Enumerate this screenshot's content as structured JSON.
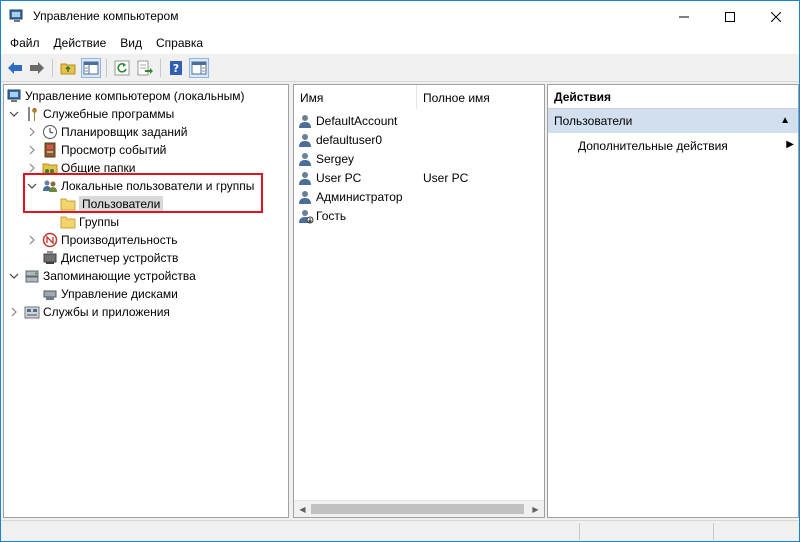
{
  "window": {
    "title": "Управление компьютером"
  },
  "menu": [
    "Файл",
    "Действие",
    "Вид",
    "Справка"
  ],
  "tree": {
    "root": "Управление компьютером (локальным)",
    "system_tools": "Служебные программы",
    "task_scheduler": "Планировщик заданий",
    "event_viewer": "Просмотр событий",
    "shared_folders": "Общие папки",
    "local_users": "Локальные пользователи и группы",
    "users": "Пользователи",
    "groups": "Группы",
    "performance": "Производительность",
    "device_manager": "Диспетчер устройств",
    "storage": "Запоминающие устройства",
    "disk_management": "Управление дисками",
    "services_apps": "Службы и приложения"
  },
  "list": {
    "columns": [
      "Имя",
      "Полное имя"
    ],
    "rows": [
      {
        "name": "DefaultAccount",
        "full_name": ""
      },
      {
        "name": "defaultuser0",
        "full_name": ""
      },
      {
        "name": "Sergey",
        "full_name": ""
      },
      {
        "name": "User PC",
        "full_name": "User PC"
      },
      {
        "name": "Администратор",
        "full_name": ""
      },
      {
        "name": "Гость",
        "full_name": ""
      }
    ]
  },
  "actions": {
    "header": "Действия",
    "section": "Пользователи",
    "more": "Дополнительные действия"
  },
  "colors": {
    "accent": "#1883d7",
    "highlight": "#e0141e",
    "section_bg": "#d1dfee"
  }
}
